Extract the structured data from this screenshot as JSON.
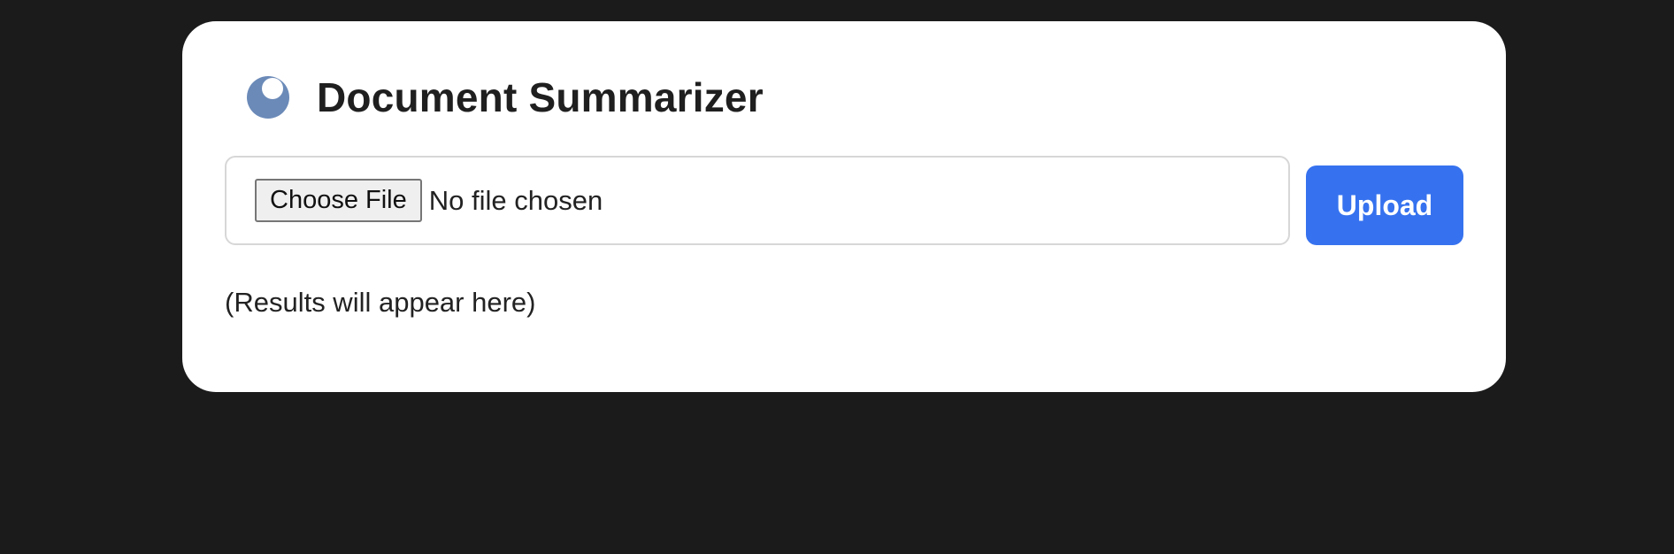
{
  "header": {
    "icon": "moon-icon",
    "title": "Document Summarizer"
  },
  "file_input": {
    "button_label": "Choose File",
    "status": "No file chosen"
  },
  "upload": {
    "label": "Upload"
  },
  "results": {
    "placeholder": "(Results will appear here)"
  },
  "colors": {
    "background": "#1b1b1b",
    "card": "#ffffff",
    "accent": "#3672ef",
    "icon": "#6b8ab8"
  }
}
